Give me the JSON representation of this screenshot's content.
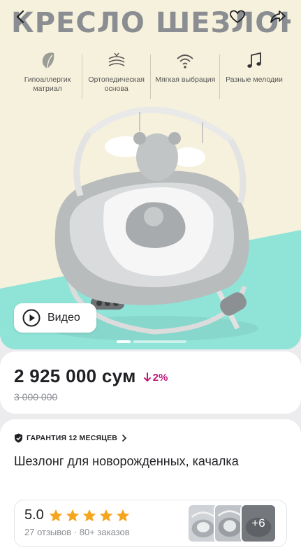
{
  "hero": {
    "title": "КРЕСЛО ШЕЗЛОНГ",
    "features": [
      {
        "icon": "leaf-icon",
        "label": "Гипоаллергик матриал"
      },
      {
        "icon": "layers-icon",
        "label": "Ортопедическая основа"
      },
      {
        "icon": "wifi-icon",
        "label": "Мягкая выбрация"
      },
      {
        "icon": "music-note-icon",
        "label": "Разные мелодии"
      }
    ],
    "video_label": "Видео",
    "colors": {
      "cream": "#f6f1dc",
      "teal": "#8fe3d7"
    }
  },
  "header": {
    "back_icon": "chevron-left-icon",
    "favorite_icon": "heart-icon",
    "share_icon": "share-icon"
  },
  "pricing": {
    "price": "2 925 000 сум",
    "discount": "2%",
    "old_price": "3 000 000",
    "discount_color": "#c21a7a"
  },
  "product": {
    "warranty": "ГАРАНТИЯ 12 МЕСЯЦЕВ",
    "name": "Шезлонг для новорожденных, качалка",
    "rating": "5.0",
    "stars": 5,
    "reviews": "27 отзывов",
    "orders": "80+ заказов",
    "separator": "·",
    "more_photos": "+6",
    "star_color": "#f6a51f"
  }
}
